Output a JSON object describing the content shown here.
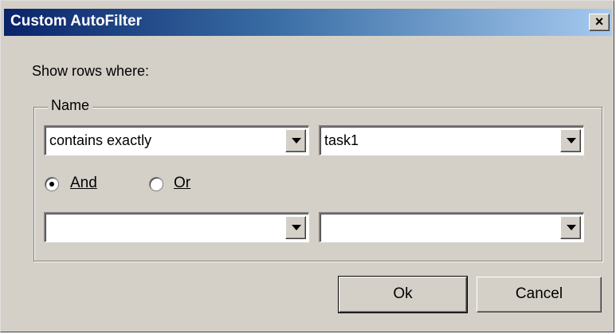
{
  "dialog": {
    "title": "Custom AutoFilter",
    "close_glyph": "×",
    "instruction": "Show rows where:"
  },
  "group": {
    "legend": "Name"
  },
  "row1": {
    "operator_value": "contains exactly",
    "value_value": "task1"
  },
  "logic": {
    "and_label": "And",
    "or_label": "Or",
    "selected": "And"
  },
  "row2": {
    "operator_value": "",
    "value_value": ""
  },
  "buttons": {
    "ok_label": "Ok",
    "cancel_label": "Cancel"
  },
  "icons": {
    "close": "close-icon",
    "dropdown": "chevron-down-icon"
  }
}
